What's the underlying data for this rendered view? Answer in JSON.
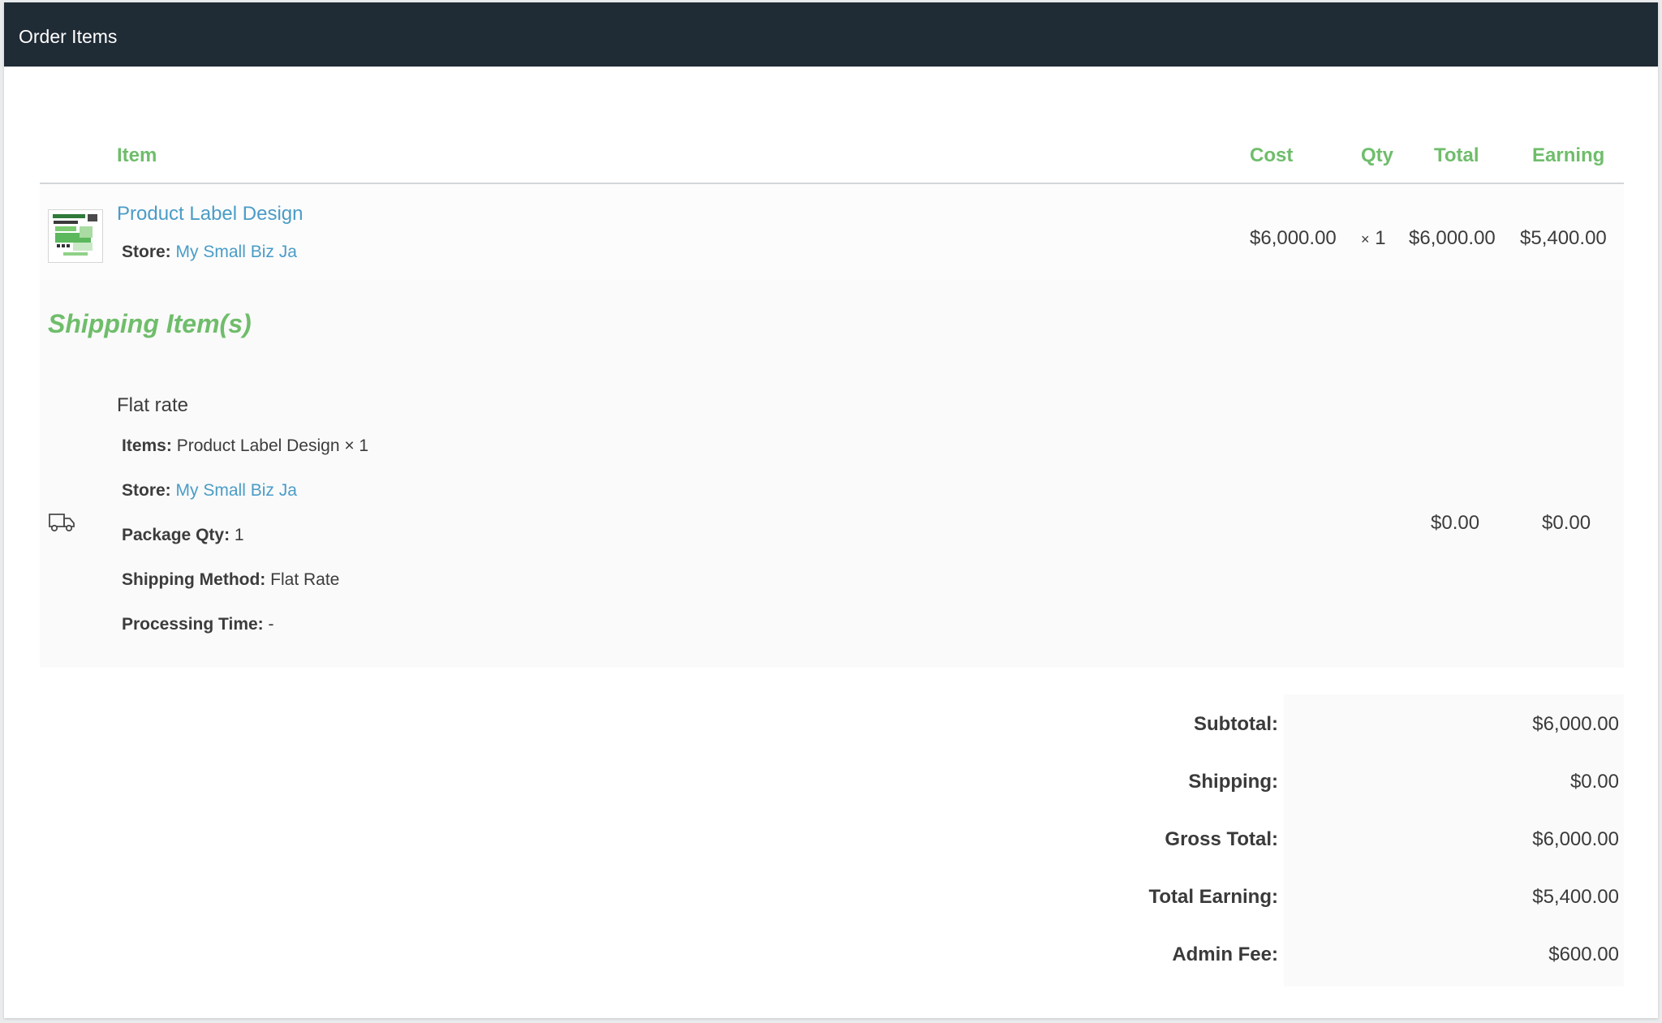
{
  "header": {
    "title": "Order Items"
  },
  "columns": {
    "item": "Item",
    "cost": "Cost",
    "qty": "Qty",
    "total": "Total",
    "earning": "Earning"
  },
  "item": {
    "name": "Product Label Design",
    "store_label": "Store:",
    "store_name": "My Small Biz Ja",
    "cost": "$6,000.00",
    "qty_prefix": "×",
    "qty": "1",
    "total": "$6,000.00",
    "earning": "$5,400.00",
    "thumbnail_icon": "product-label-thumbnail"
  },
  "shipping": {
    "section_title": "Shipping Item(s)",
    "icon": "truck-icon",
    "method_name": "Flat rate",
    "items_label": "Items:",
    "items_value": "Product Label Design × 1",
    "store_label": "Store:",
    "store_name": "My Small Biz Ja",
    "package_qty_label": "Package Qty:",
    "package_qty_value": "1",
    "shipping_method_label": "Shipping Method:",
    "shipping_method_value": "Flat Rate",
    "processing_time_label": "Processing Time:",
    "processing_time_value": "-",
    "total": "$0.00",
    "earning": "$0.00"
  },
  "totals": [
    {
      "label": "Subtotal:",
      "value": "$6,000.00"
    },
    {
      "label": "Shipping:",
      "value": "$0.00"
    },
    {
      "label": "Gross Total:",
      "value": "$6,000.00"
    },
    {
      "label": "Total Earning:",
      "value": "$5,400.00"
    },
    {
      "label": "Admin Fee:",
      "value": "$600.00"
    }
  ],
  "colors": {
    "header_bg": "#1f2b35",
    "accent_green": "#6fbd6b",
    "link_blue": "#4a9cc7"
  }
}
